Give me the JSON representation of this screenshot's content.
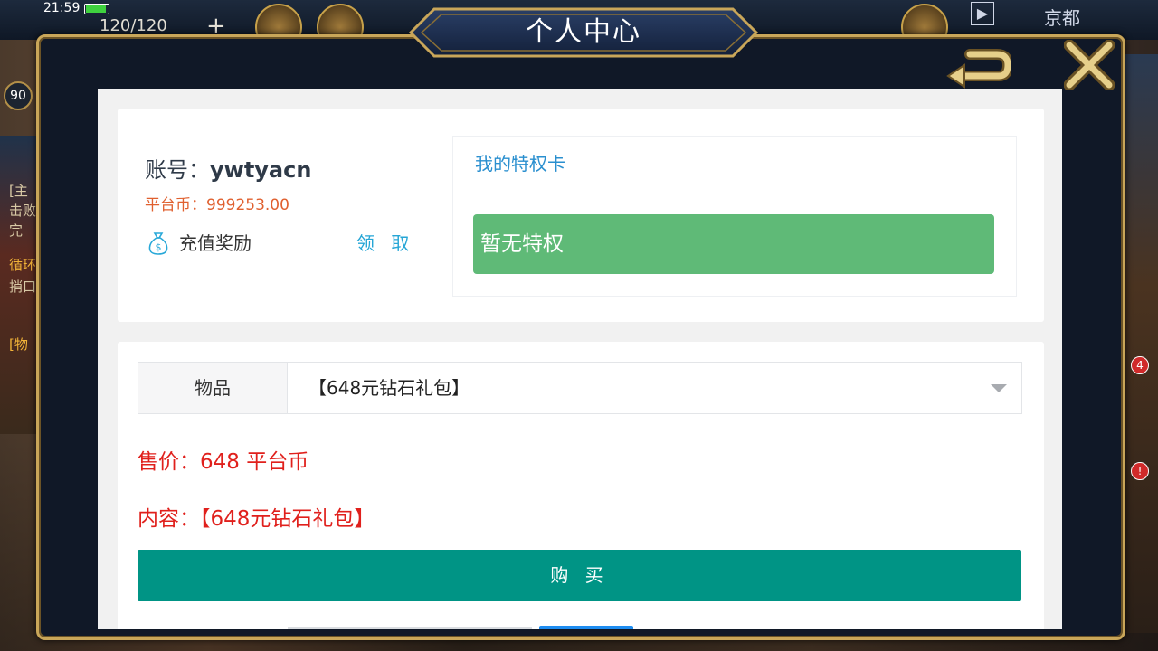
{
  "status_bar": {
    "time": "21:59"
  },
  "hud": {
    "stamina": "120/120",
    "stamina_plus": "+",
    "city": "京都",
    "level": "90",
    "badge_1": "4",
    "badge_2": "!"
  },
  "left_hints": [
    "[主",
    "击败",
    "完",
    "循环",
    "捎口",
    "[物"
  ],
  "modal": {
    "title": "个人中心",
    "account_label": "账号：",
    "account_name": "ywtyacn",
    "coins_label": "平台币：",
    "coins_value": "999253.00",
    "reward_label": "充值奖励",
    "claim_label": "领 取",
    "privilege_title": "我的特权卡",
    "privilege_empty": "暂无特权",
    "item_label": "物品",
    "item_selected": "【648元钻石礼包】",
    "price_text": "售价：648 平台币",
    "content_text": "内容：【648元钻石礼包】",
    "buy_label": "购 买"
  },
  "icons": {
    "back": "back-arrow-icon",
    "close": "close-x-icon",
    "reward": "money-bag-icon",
    "dropdown": "caret-down-icon"
  },
  "colors": {
    "privilege_green": "#5fba77",
    "buy_teal": "#009485",
    "price_red": "#e0201c",
    "coins_orange": "#e0602f",
    "link_blue": "#2a8fcf"
  }
}
